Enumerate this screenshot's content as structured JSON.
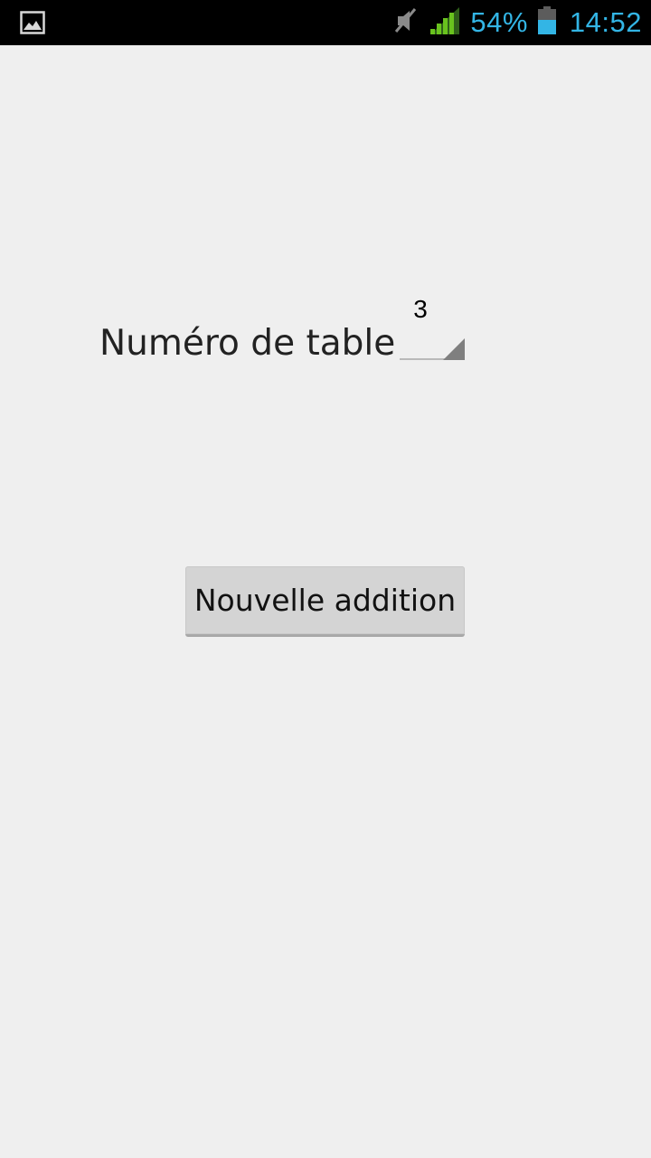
{
  "status_bar": {
    "notification_icon": "image-icon",
    "mute_icon": "muted-speaker-icon",
    "signal_icon": "signal-bars-icon",
    "battery_percent": "54%",
    "battery_icon": "battery-icon",
    "clock": "14:52",
    "accent_color": "#33b5e5"
  },
  "form": {
    "table_label": "Numéro de table",
    "table_number": "3"
  },
  "actions": {
    "new_bill_label": "Nouvelle addition"
  }
}
